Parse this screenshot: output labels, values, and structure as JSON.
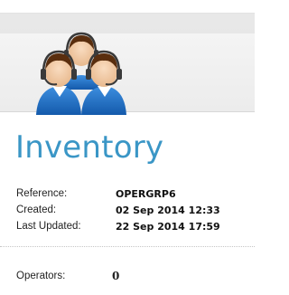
{
  "page": {
    "title": "Inventory"
  },
  "details": {
    "reference_label": "Reference:",
    "reference_value": "OPERGRP6",
    "created_label": "Created:",
    "created_value": "02 Sep 2014 12:33",
    "updated_label": "Last Updated:",
    "updated_value": "22 Sep 2014 17:59"
  },
  "operators": {
    "label": "Operators:",
    "value": "0"
  },
  "icons": {
    "header": "operator-group-icon"
  },
  "colors": {
    "title": "#3a96c6",
    "icon_body": "#1f6fc2",
    "icon_skin": "#f2c8a0",
    "icon_hair": "#5a2e0e"
  }
}
